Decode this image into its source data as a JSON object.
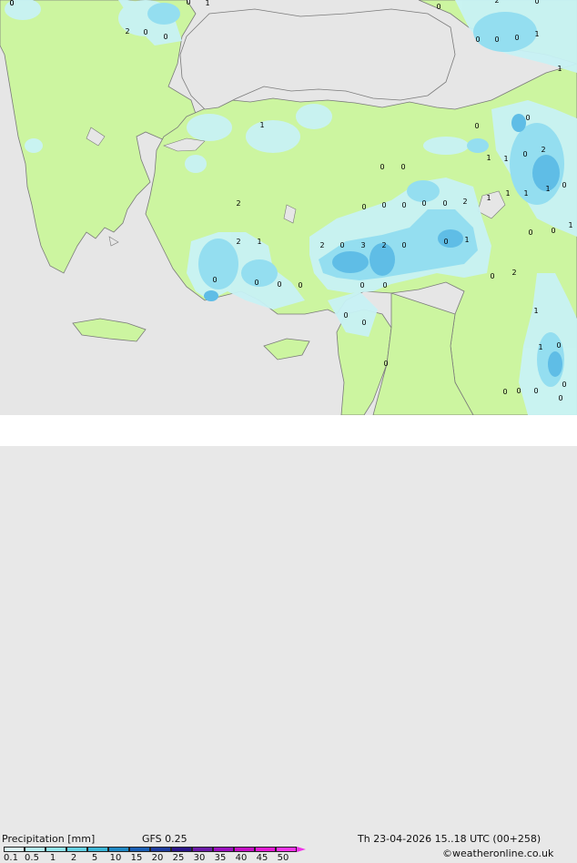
{
  "footer": {
    "title": "Precipitation [mm]",
    "model": "GFS 0.25",
    "valid_time": "Th 23-04-2026 15..18 UTC (00+258)",
    "credit": "©weatheronline.co.uk"
  },
  "legend": {
    "ticks": [
      "0.1",
      "0.5",
      "1",
      "2",
      "5",
      "10",
      "15",
      "20",
      "25",
      "30",
      "35",
      "40",
      "45",
      "50"
    ],
    "colors": [
      "#d9f5f7",
      "#b3eef3",
      "#8fe3ec",
      "#64d0e2",
      "#3ab5d6",
      "#1f88c4",
      "#1a5fb4",
      "#1d3c9e",
      "#2a168a",
      "#6b1aa8",
      "#9a10be",
      "#c40fc4",
      "#e21ad4",
      "#f033e8"
    ]
  },
  "map": {
    "colors": {
      "sea": "#e6e6e6",
      "land_dry": "#ccf5a0",
      "precip_light": "#c8f2f5",
      "precip_med": "#94def0",
      "precip_heavy": "#5fbde6",
      "border": "#7a7a7a"
    },
    "value_labels": [
      "0",
      "0",
      "1",
      "2",
      "0",
      "0",
      "0",
      "2",
      "0",
      "0",
      "0",
      "0",
      "1",
      "1",
      "0",
      "0",
      "1",
      "2",
      "0",
      "1",
      "1",
      "0",
      "0",
      "1",
      "1",
      "1",
      "0",
      "1",
      "0",
      "0",
      "0",
      "0",
      "0",
      "2",
      "1",
      "2",
      "0",
      "3",
      "2",
      "0",
      "0",
      "1",
      "0",
      "0",
      "2",
      "2",
      "1",
      "0",
      "0",
      "0",
      "0",
      "0",
      "0",
      "0",
      "2",
      "1",
      "0",
      "0",
      "1",
      "0",
      "0",
      "0",
      "0",
      "0",
      "0",
      "0",
      "0"
    ]
  }
}
